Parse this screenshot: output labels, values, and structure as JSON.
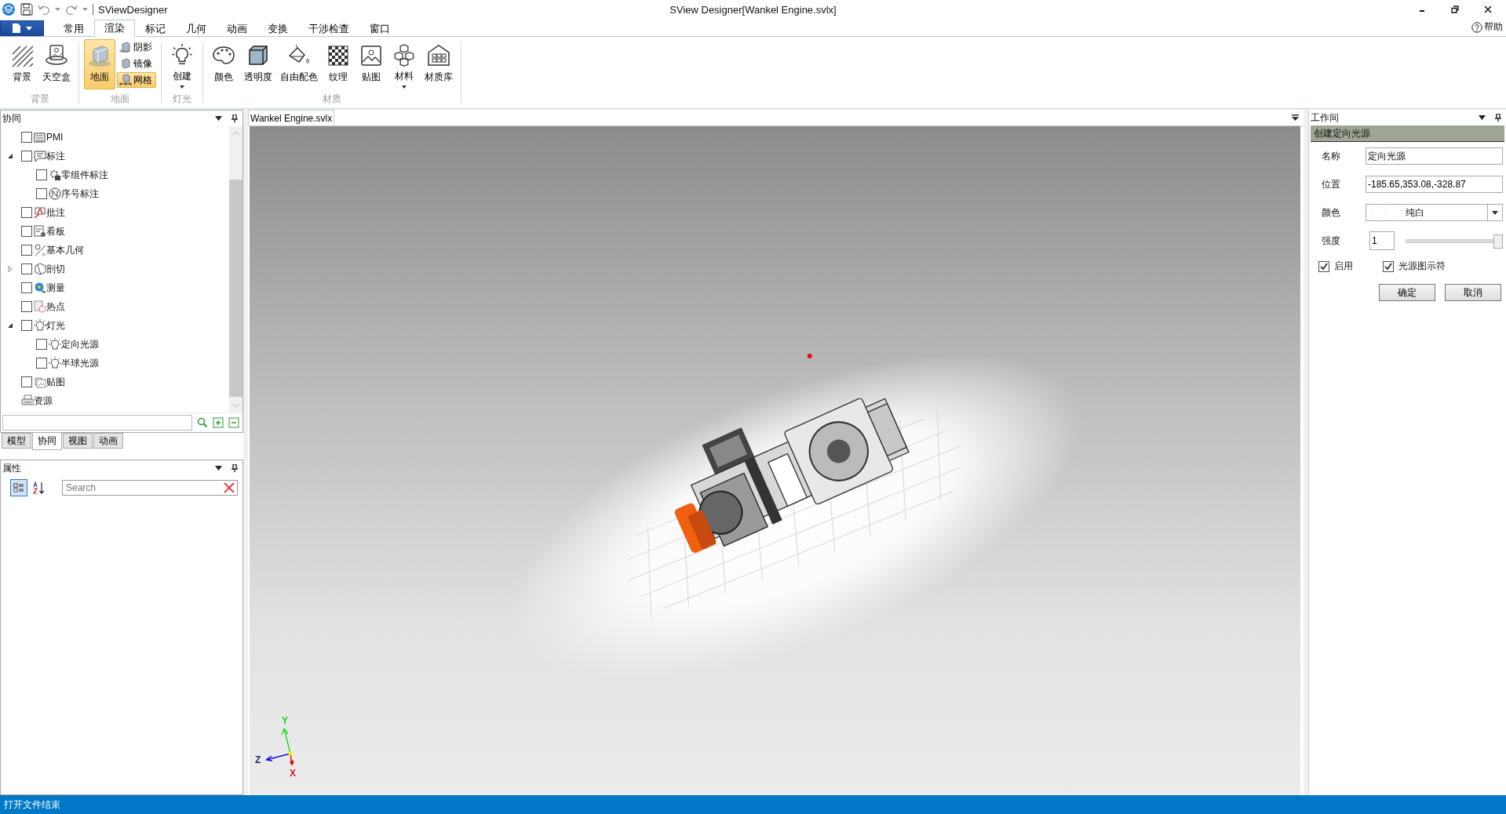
{
  "title_bar": {
    "app_name": "SViewDesigner",
    "window_title": "SView Designer[Wankel Engine.svlx]"
  },
  "ribbon_tabs": [
    {
      "label": "常用",
      "selected": false
    },
    {
      "label": "渲染",
      "selected": true
    },
    {
      "label": "标记",
      "selected": false
    },
    {
      "label": "几何",
      "selected": false
    },
    {
      "label": "动画",
      "selected": false
    },
    {
      "label": "变换",
      "selected": false
    },
    {
      "label": "干涉检查",
      "selected": false
    },
    {
      "label": "窗口",
      "selected": false
    }
  ],
  "help": "帮助",
  "ribbon_groups": [
    {
      "label": "背景",
      "buttons": [
        {
          "label": "背景",
          "kind": "large",
          "selected": false,
          "dropdown": false
        },
        {
          "label": "天空盒",
          "kind": "large",
          "selected": false,
          "dropdown": false
        }
      ]
    },
    {
      "label": "地面",
      "buttons": [
        {
          "label": "地面",
          "kind": "large",
          "selected": true,
          "dropdown": false
        },
        {
          "label": "阴影",
          "kind": "small",
          "selected": false,
          "dropdown": false
        },
        {
          "label": "镜像",
          "kind": "small",
          "selected": false,
          "dropdown": false
        },
        {
          "label": "网格",
          "kind": "small",
          "selected": true,
          "dropdown": false
        }
      ]
    },
    {
      "label": "灯光",
      "buttons": [
        {
          "label": "创建",
          "kind": "large",
          "selected": false,
          "dropdown": true
        }
      ]
    },
    {
      "label": "材质",
      "buttons": [
        {
          "label": "颜色",
          "kind": "large",
          "selected": false,
          "dropdown": false
        },
        {
          "label": "透明度",
          "kind": "large",
          "selected": false,
          "dropdown": false
        },
        {
          "label": "自由配色",
          "kind": "large",
          "selected": false,
          "dropdown": false
        },
        {
          "label": "纹理",
          "kind": "large",
          "selected": false,
          "dropdown": false
        },
        {
          "label": "贴图",
          "kind": "large",
          "selected": false,
          "dropdown": false
        },
        {
          "label": "材料",
          "kind": "large",
          "selected": false,
          "dropdown": true
        },
        {
          "label": "材质库",
          "kind": "large",
          "selected": false,
          "dropdown": false
        }
      ]
    }
  ],
  "collab_panel": {
    "title": "协同",
    "tree": [
      {
        "label": "PMI",
        "kind": "checkbox",
        "checked": false
      },
      {
        "label": "标注",
        "kind": "checkbox",
        "checked": false,
        "expanded": true,
        "children": [
          {
            "label": "零组件标注",
            "kind": "checkbox",
            "checked": false
          },
          {
            "label": "序号标注",
            "kind": "checkbox",
            "checked": false
          }
        ]
      },
      {
        "label": "批注",
        "kind": "checkbox",
        "checked": false
      },
      {
        "label": "看板",
        "kind": "checkbox",
        "checked": false
      },
      {
        "label": "基本几何",
        "kind": "checkbox",
        "checked": false
      },
      {
        "label": "剖切",
        "kind": "checkbox",
        "checked": false,
        "expanded": false
      },
      {
        "label": "测量",
        "kind": "checkbox",
        "checked": false
      },
      {
        "label": "热点",
        "kind": "checkbox",
        "checked": false
      },
      {
        "label": "灯光",
        "kind": "checkbox",
        "checked": false,
        "expanded": true,
        "children": [
          {
            "label": "定向光源",
            "kind": "checkbox",
            "checked": false
          },
          {
            "label": "半球光源",
            "kind": "checkbox",
            "checked": false
          }
        ]
      },
      {
        "label": "贴图",
        "kind": "checkbox",
        "checked": false
      },
      {
        "label": "资源",
        "kind": "plain"
      }
    ]
  },
  "panel_tabs": [
    {
      "label": "模型",
      "selected": false
    },
    {
      "label": "协同",
      "selected": true
    },
    {
      "label": "视图",
      "selected": false
    },
    {
      "label": "动画",
      "selected": false
    }
  ],
  "properties_panel": {
    "title": "属性",
    "view_modes": [
      {
        "selected": true
      },
      {
        "selected": false
      }
    ],
    "search": {
      "placeholder": "Search"
    }
  },
  "document_tab": {
    "label": "Wankel Engine.svlx"
  },
  "axes": [
    {
      "label": "Y",
      "color": "#22cc22"
    },
    {
      "label": "Z",
      "color": "#1a2a6a"
    },
    {
      "label": "X",
      "color": "#cc2222"
    }
  ],
  "workspace": {
    "title": "工作间",
    "header": "创建定向光源",
    "name": {
      "label": "名称",
      "value": "定向光源"
    },
    "position": {
      "label": "位置",
      "value": "-185.65,353.08,-328.87"
    },
    "color": {
      "label": "颜色",
      "value": "纯白"
    },
    "intensity": {
      "label": "强度",
      "value": "1",
      "level": 1
    },
    "options": [
      {
        "label": "启用",
        "checked": true
      },
      {
        "label": "光源图示符",
        "checked": true
      }
    ],
    "buttons": [
      "确定",
      "取消"
    ]
  },
  "status_bar": {
    "message": "打开文件结束"
  }
}
